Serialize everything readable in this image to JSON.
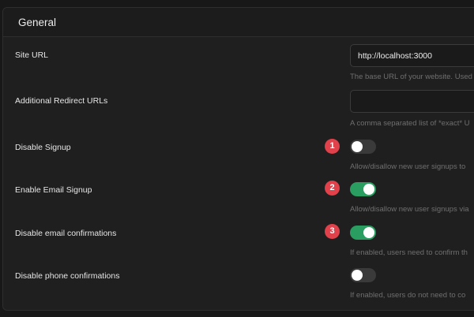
{
  "panel": {
    "title": "General"
  },
  "settings": {
    "site_url": {
      "label": "Site URL",
      "value": "http://localhost:3000",
      "help": "The base URL of your website. Used"
    },
    "redirect_urls": {
      "label": "Additional Redirect URLs",
      "value": "",
      "help": "A comma separated list of *exact* U"
    },
    "disable_signup": {
      "label": "Disable Signup",
      "enabled": false,
      "help": "Allow/disallow new user signups to"
    },
    "enable_email_signup": {
      "label": "Enable Email Signup",
      "enabled": true,
      "help": "Allow/disallow new user signups via"
    },
    "disable_email_confirmations": {
      "label": "Disable email confirmations",
      "enabled": true,
      "help": "If enabled, users need to confirm th"
    },
    "disable_phone_confirmations": {
      "label": "Disable phone confirmations",
      "enabled": false,
      "help": "If enabled, users do not need to co"
    }
  },
  "annotations": [
    "1",
    "2",
    "3"
  ],
  "colors": {
    "toggle_on": "#2a9d61",
    "toggle_off": "#3a3a3a",
    "badge": "#e0414a"
  }
}
